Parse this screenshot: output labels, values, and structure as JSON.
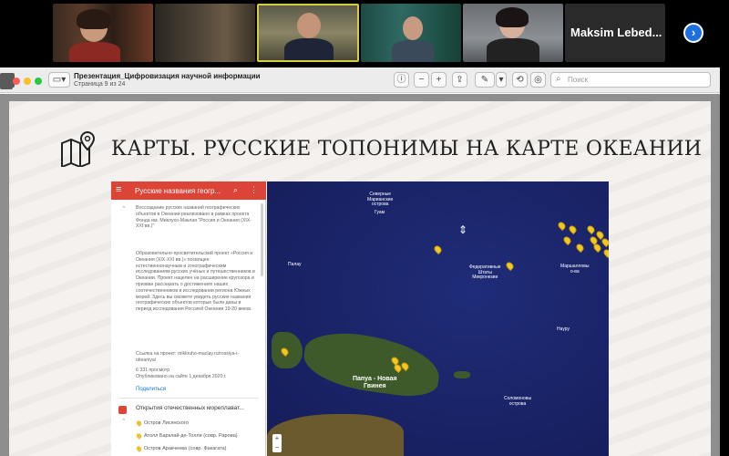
{
  "participants": {
    "named_tile_label": "Maksim Lebed..."
  },
  "video_strip": {
    "next_page_icon": "chevron-right-icon"
  },
  "window": {
    "doc_title": "Презентация_Цифровизация научной информации",
    "doc_subtitle": "Страница 9 из 24",
    "search_placeholder": "Поиск"
  },
  "slide": {
    "heading": "КАРТЫ. РУССКИЕ ТОПОНИМЫ НА КАРТЕ ОКЕАНИИ",
    "heading_icon": "map-pin-icon"
  },
  "map": {
    "panel_title": "Русские названия геогр...",
    "description_1": "Воссоздание русских названий географических объектов в Океании реализовано в рамках проекта Фонда им. Миклухо-Маклая \"Россия и Океания (XIX-XXI вв.)\"",
    "description_2": "Образовательно-просветительский проект «Россия и Океания (XIX-XXI вв.)» посвящен естественнонаучным и этнографическим исследованиям русских учёных и путешественников в Океании. Проект нацелен на расширение кругозора и призван рассказать о достижениях наших соотечественников в исследовании региона Южных морей. Здесь вы сможете увидеть русские названия географических объектов которые были даны в период исследования Россией Океании 19-20 веков.",
    "link_line": "Ссылка на проект: miklouho-maclay.ru/rossiya-i-okeaniya/",
    "views": "6 331 просмотр",
    "published": "Опубликовано на сайте 1 декабря 2020 г.",
    "share": "Поделиться",
    "layer_title": "Открытия отечественных мореплават...",
    "layer_items": [
      "Остров Лисянского",
      "Атолл Барклай-де-Толли (совр. Рароиа)",
      "Остров Аракчеева (совр. Факагата)"
    ],
    "labels": {
      "north_mariana": "Северные\nМарианские\nострова",
      "guam": "Гуам",
      "palau": "Палау",
      "micronesia": "Федеративные\nШтаты\nМикронезии",
      "marshall": "Маршалловы\nо-ва",
      "nauru": "Науру",
      "papua": "Папуа - Новая\nГвинея",
      "solomon": "Соломоновы\nострова",
      "compass": "N"
    },
    "zoom_in": "+",
    "zoom_out": "−"
  }
}
